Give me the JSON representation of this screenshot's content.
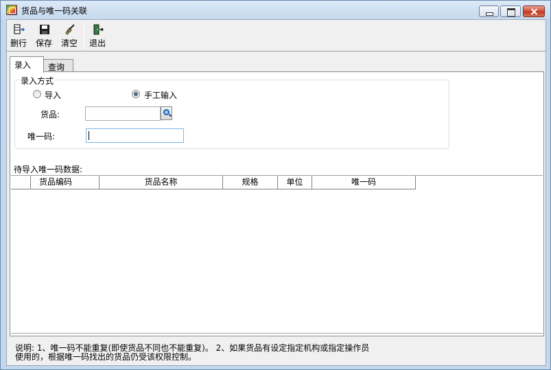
{
  "window": {
    "title": "货品与唯一码关联"
  },
  "toolbar": {
    "buttons": [
      {
        "label": "删行",
        "icon": "delete-row-icon"
      },
      {
        "label": "保存",
        "icon": "save-icon"
      },
      {
        "label": "清空",
        "icon": "broom-icon"
      },
      {
        "label": "退出",
        "icon": "exit-door-icon"
      }
    ]
  },
  "tabs": [
    {
      "label": "录入",
      "active": true
    },
    {
      "label": "查询",
      "active": false
    }
  ],
  "entry": {
    "group_title": "录入方式",
    "mode_options": [
      {
        "label": "导入",
        "selected": false
      },
      {
        "label": "手工输入",
        "selected": true
      }
    ],
    "goods_label": "货品:",
    "goods_value": "",
    "unique_code_label": "唯一码:",
    "unique_code_value": ""
  },
  "pending": {
    "label": "待导入唯一码数据:",
    "columns": [
      "",
      "货品编码",
      "货品名称",
      "规格",
      "单位",
      "唯一码"
    ],
    "rows": []
  },
  "footer": {
    "note_line1": "说明: 1、唯一码不能重复(即使货品不同也不能重复)。 2、如果货品有设定指定机构或指定操作员",
    "note_line2": "使用的，根据唯一码找出的货品仍受该权限控制。"
  },
  "colors": {
    "titlebar": "#c6d9ee",
    "close_button": "#c0361e",
    "panel_bg": "#ffffff",
    "client_bg": "#f0f0f0"
  }
}
